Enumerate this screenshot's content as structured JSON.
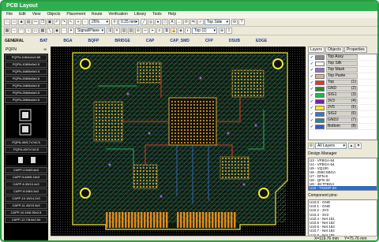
{
  "window": {
    "title": "PCB Layout",
    "accent": "#2fae4f"
  },
  "menu": [
    "File",
    "Edit",
    "View",
    "Objects",
    "Placement",
    "Route",
    "Verification",
    "Library",
    "Tools",
    "Help"
  ],
  "toolbar": {
    "zoom_value": "25%",
    "grid_value": "0.25 mm",
    "layer_value": "Top Side",
    "net_value": "Signal/Plane",
    "top_value": "Top (1)"
  },
  "lib_tabs": [
    "GENERAL",
    "BAT",
    "BGA",
    "BQFP",
    "BRIDGE",
    "CAP",
    "CAP_SMD",
    "CFP",
    "DSUB",
    "EDGE"
  ],
  "lib_header": "PQFN",
  "lib_items_top": [
    "PQFN-108/4x4x0.65",
    "PQFN-108/5x5x0.5",
    "PQFN-168/5x5x0.5",
    "PQFN-208/5x5x0.5",
    "PQFN-248/5x5x0.5",
    "PQFN-256/6x6x0.5",
    "PQFN-288/6x6x0.5"
  ],
  "lib_items_mid": [
    "PQFN-40/6.7x7x0.5",
    "PQFN-40/7x7x0.5"
  ],
  "lib_items_bottom": [
    "CAPP-2.5/4/0.8x3",
    "CAPP-5.8/8/5.15x3",
    "CAPP-6.35/10.4x3",
    "CAPP-8.5/8/4.5x3",
    "CAPP-10.16/14.2x3",
    "CAPP-11.43/15.3x3",
    "CAPP-10.16/6.35x2.8",
    "CAPP-12.7/8.8x2.54"
  ],
  "right_tabs": [
    "Layers",
    "Objects",
    "Properties"
  ],
  "layers": [
    {
      "name": "Top Assy",
      "num": "",
      "color": "#8a8a8a"
    },
    {
      "name": "Top Silk",
      "num": "",
      "color": "#f2f2f2"
    },
    {
      "name": "Top Mask",
      "num": "",
      "color": "#9a6bc4"
    },
    {
      "name": "Top Paste",
      "num": "",
      "color": "#d6b18c"
    },
    {
      "name": "Top",
      "num": "(1)",
      "color": "#e23a1f"
    },
    {
      "name": "GND",
      "num": "(2)",
      "color": "#1f8a3a"
    },
    {
      "name": "SIG1",
      "num": "(3)",
      "color": "#2ab24a"
    },
    {
      "name": "3V3",
      "num": "(4)",
      "color": "#7a1fa8"
    },
    {
      "name": "2V5",
      "num": "(5)",
      "color": "#f0e83a"
    },
    {
      "name": "SIG2",
      "num": "(6)",
      "color": "#3e74c9"
    },
    {
      "name": "GND2",
      "num": "(7)",
      "color": "#1c8d99"
    },
    {
      "name": "Bottom",
      "num": "(8)",
      "color": "#3a56d6"
    }
  ],
  "all_layers": "All Layers",
  "design_manager": {
    "title": "Design Manager",
    "items": [
      "U3 - VFBGA-54",
      "U4 - VFBGA-54",
      "U5 - VQ100",
      "U6 - 256CSBGA",
      "U7 - DFN-8",
      "U8 - QFN-32",
      "U9 - 48-TFBGA",
      "U10 - TSSOP-20"
    ],
    "selected": "U10 - TSSOP-20"
  },
  "component_pins": {
    "title": "Component pins:",
    "items": [
      "U10.0 - GND",
      "U10.1 - GND",
      "U10.2 - 3V3",
      "U10.3 - 3V3",
      "U10.4 - Net 151",
      "U10.5 - Net 152",
      "U10.6 - Net 153",
      "U10.7 - Net 154",
      "U10.8 - Net 155"
    ]
  },
  "status": {
    "x": "X=119.76 mm",
    "y": "Y=75.76 mm"
  }
}
